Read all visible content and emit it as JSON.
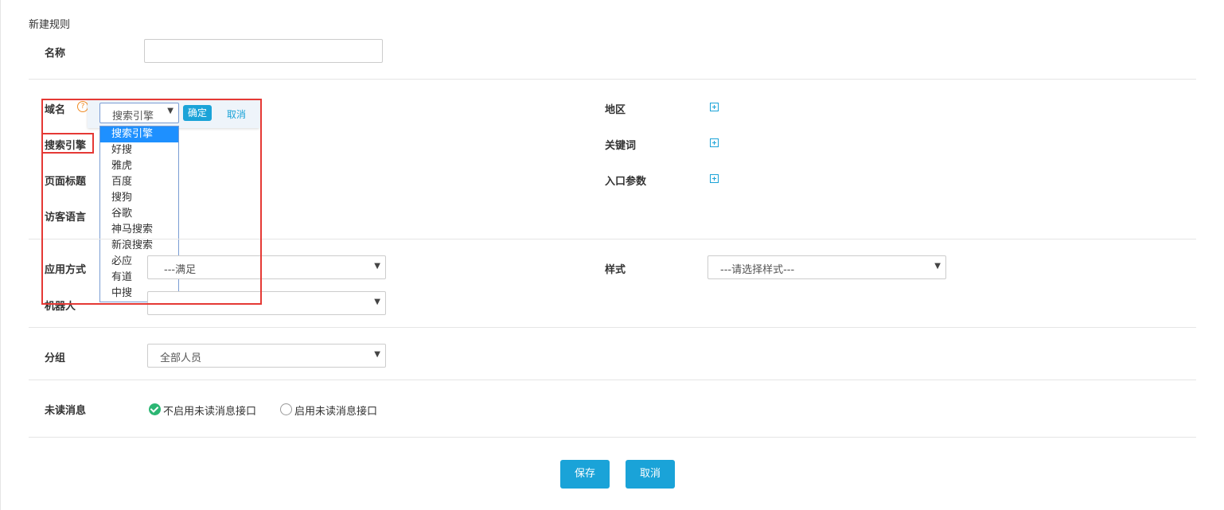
{
  "page": {
    "title": "新建规则"
  },
  "name_field": {
    "label": "名称",
    "value": ""
  },
  "domain": {
    "label": "域名",
    "help_icon": "question-icon",
    "select_value": "搜索引擎",
    "confirm_label": "确定",
    "cancel_label": "取消",
    "options": [
      "搜索引擎",
      "好搜",
      "雅虎",
      "百度",
      "搜狗",
      "谷歌",
      "神马搜索",
      "新浪搜索",
      "必应",
      "有道",
      "中搜"
    ]
  },
  "left_rows": {
    "search_engine": "搜索引擎",
    "page_title": "页面标题",
    "visitor_lang": "访客语言"
  },
  "right_rows": {
    "region": "地区",
    "keyword": "关键词",
    "entry_params": "入口参数",
    "add_icon": "plus-square-icon"
  },
  "apply_mode": {
    "label": "应用方式",
    "value": "---满足"
  },
  "robot": {
    "label": "机器人",
    "value": ""
  },
  "style": {
    "label": "样式",
    "value": "---请选择样式---"
  },
  "group": {
    "label": "分组",
    "value": "全部人员"
  },
  "unread": {
    "label": "未读消息",
    "option_off": "不启用未读消息接口",
    "option_on": "启用未读消息接口",
    "selected": "不启用未读消息接口"
  },
  "footer": {
    "save_label": "保存",
    "cancel_label": "取消"
  },
  "colors": {
    "accent": "#1aa3d8",
    "highlight": "#e53935",
    "selected_option": "#1e90ff",
    "check": "#2bb673"
  }
}
